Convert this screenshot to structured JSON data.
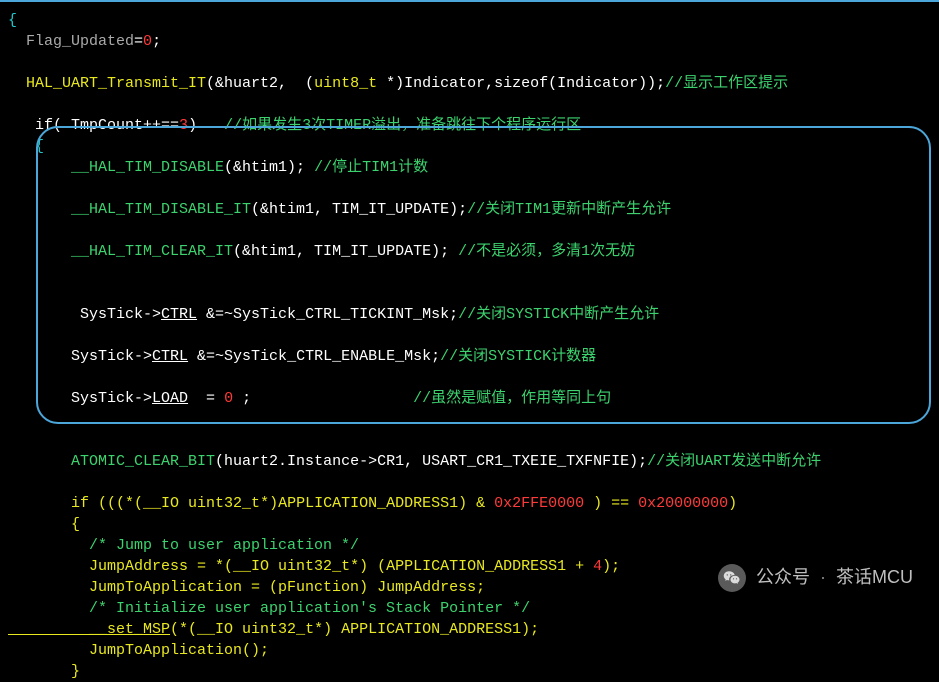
{
  "l1": "{",
  "l2a": "  Flag_Updated",
  "l2b": "=",
  "l2c": "0",
  "l2d": ";",
  "l4a": "  HAL_UART_Transmit_IT",
  "l4b": "(&huart2,  (",
  "l4c": "uint8_t",
  "l4d": " *)Indicator,",
  "l4e": "sizeof",
  "l4f": "(Indicator));",
  "l4g": "//显示工作区提示",
  "l6a": "   if",
  "l6b": "( TmpCount++==",
  "l6c": "3",
  "l6d": ")   ",
  "l6e": "//如果发生3次TIMER溢出，准备跳往下个程序运行区",
  "l7": "   {",
  "l8a": "       __HAL_TIM_DISABLE",
  "l8b": "(&htim1); ",
  "l8c": "//停止TIM1计数",
  "l10a": "       __HAL_TIM_DISABLE_IT",
  "l10b": "(&htim1, TIM_IT_UPDATE);",
  "l10c": "//关闭TIM1更新中断产生允许",
  "l12a": "       __HAL_TIM_CLEAR_IT",
  "l12b": "(&htim1, TIM_IT_UPDATE); ",
  "l12c": "//不是必须，多清1次无妨",
  "l15a": "        SysTick->",
  "l15b": "CTRL",
  "l15c": " &=~SysTick_CTRL_TICKINT_Msk;",
  "l15d": "//关闭SYSTICK中断产生允许",
  "l17a": "       SysTick->",
  "l17b": "CTRL",
  "l17c": " &=~SysTick_CTRL_ENABLE_Msk;",
  "l17d": "//关闭SYSTICK计数器",
  "l19a": "       SysTick->",
  "l19b": "LOAD",
  "l19c": "  = ",
  "l19d": "0",
  "l19e": " ;                  ",
  "l19f": "//虽然是赋值，作用等同上句",
  "l22a": "       ATOMIC_CLEAR_BIT",
  "l22b": "(huart2.Instance->CR1, USART_CR1_TXEIE_TXFNFIE);",
  "l22c": "//关闭UART发送中断允许",
  "l24a": "       if ",
  "l24b": "(((*(",
  "l24c": "__IO uint32_t",
  "l24d": "*)APPLICATION_ADDRESS1) & ",
  "l24e": "0x2FFE0000",
  "l24f": " ) == ",
  "l24g": "0x20000000",
  "l24h": ")",
  "l25": "       {",
  "l26": "         /* Jump to user application */",
  "l27a": "         JumpAddress = *(",
  "l27b": "__IO uint32_t",
  "l27c": "*) (APPLICATION_ADDRESS1 + ",
  "l27d": "4",
  "l27e": ");",
  "l28a": "         JumpToApplication = (",
  "l28b": "pFunction",
  "l28c": ") JumpAddress;",
  "l29": "         /* Initialize user application's Stack Pointer */",
  "l30a": "         __set_MSP",
  "l30b": "(*(",
  "l30c": "__IO uint32_t",
  "l30d": "*) APPLICATION_ADDRESS1);",
  "l31": "         JumpToApplication();",
  "l32": "       }",
  "watermark_label": "公众号",
  "watermark_name": "茶话MCU"
}
